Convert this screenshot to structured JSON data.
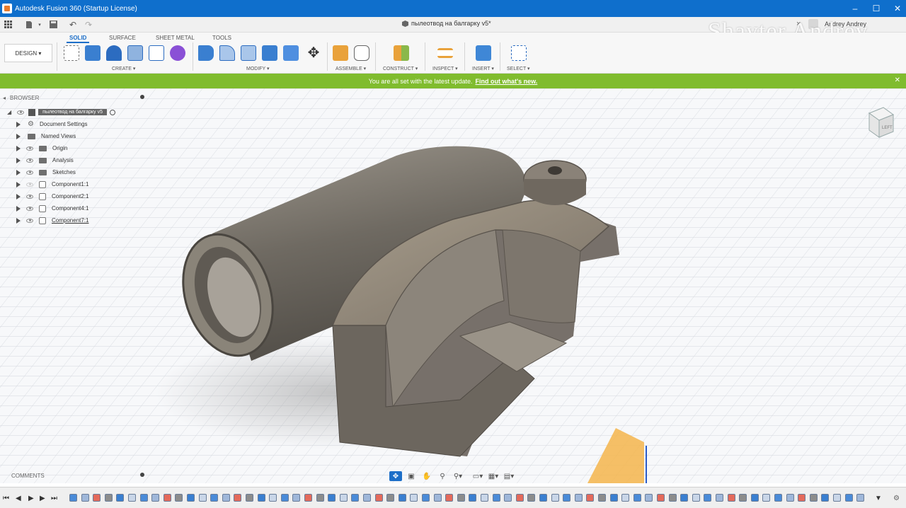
{
  "window": {
    "title": "Autodesk Fusion 360 (Startup License)",
    "minimize": "–",
    "maximize": "☐",
    "close": "✕"
  },
  "quick_access": {
    "doc_title": "пылеотвод на балгарку v5*",
    "user": "Andrey Andrey",
    "close_tab": "×",
    "add_tab": "+"
  },
  "watermark": "Shayter Andrey",
  "ribbon": {
    "design_label": "DESIGN ▾",
    "tabs": [
      "SOLID",
      "SURFACE",
      "SHEET METAL",
      "TOOLS"
    ],
    "groups": {
      "create": "CREATE ▾",
      "modify": "MODIFY ▾",
      "assemble": "ASSEMBLE ▾",
      "construct": "CONSTRUCT ▾",
      "inspect": "INSPECT ▾",
      "insert": "INSERT ▾",
      "select": "SELECT ▾"
    }
  },
  "banner": {
    "text": "You are all set with the latest update.",
    "link": "Find out what's new.",
    "close": "✕"
  },
  "browser": {
    "header": "BROWSER",
    "root": "пылеотвод на балгарку v5",
    "items": [
      "Document Settings",
      "Named Views",
      "Origin",
      "Analysis",
      "Sketches",
      "Component1:1",
      "Component2:1",
      "Component4:1",
      "Component7:1"
    ]
  },
  "comments": {
    "label": "COMMENTS"
  },
  "viewcube": {
    "face_label": "LEFT"
  },
  "colors": {
    "title_bar": "#0f6fcc",
    "banner": "#80bc2e",
    "accent": "#1d6fc8",
    "model": "#8a8479"
  }
}
